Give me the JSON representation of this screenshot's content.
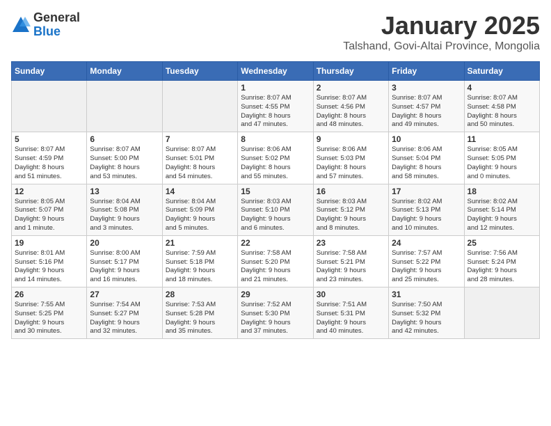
{
  "header": {
    "logo_general": "General",
    "logo_blue": "Blue",
    "month_title": "January 2025",
    "location": "Talshand, Govi-Altai Province, Mongolia"
  },
  "weekdays": [
    "Sunday",
    "Monday",
    "Tuesday",
    "Wednesday",
    "Thursday",
    "Friday",
    "Saturday"
  ],
  "weeks": [
    [
      {
        "day": "",
        "info": ""
      },
      {
        "day": "",
        "info": ""
      },
      {
        "day": "",
        "info": ""
      },
      {
        "day": "1",
        "info": "Sunrise: 8:07 AM\nSunset: 4:55 PM\nDaylight: 8 hours\nand 47 minutes."
      },
      {
        "day": "2",
        "info": "Sunrise: 8:07 AM\nSunset: 4:56 PM\nDaylight: 8 hours\nand 48 minutes."
      },
      {
        "day": "3",
        "info": "Sunrise: 8:07 AM\nSunset: 4:57 PM\nDaylight: 8 hours\nand 49 minutes."
      },
      {
        "day": "4",
        "info": "Sunrise: 8:07 AM\nSunset: 4:58 PM\nDaylight: 8 hours\nand 50 minutes."
      }
    ],
    [
      {
        "day": "5",
        "info": "Sunrise: 8:07 AM\nSunset: 4:59 PM\nDaylight: 8 hours\nand 51 minutes."
      },
      {
        "day": "6",
        "info": "Sunrise: 8:07 AM\nSunset: 5:00 PM\nDaylight: 8 hours\nand 53 minutes."
      },
      {
        "day": "7",
        "info": "Sunrise: 8:07 AM\nSunset: 5:01 PM\nDaylight: 8 hours\nand 54 minutes."
      },
      {
        "day": "8",
        "info": "Sunrise: 8:06 AM\nSunset: 5:02 PM\nDaylight: 8 hours\nand 55 minutes."
      },
      {
        "day": "9",
        "info": "Sunrise: 8:06 AM\nSunset: 5:03 PM\nDaylight: 8 hours\nand 57 minutes."
      },
      {
        "day": "10",
        "info": "Sunrise: 8:06 AM\nSunset: 5:04 PM\nDaylight: 8 hours\nand 58 minutes."
      },
      {
        "day": "11",
        "info": "Sunrise: 8:05 AM\nSunset: 5:05 PM\nDaylight: 9 hours\nand 0 minutes."
      }
    ],
    [
      {
        "day": "12",
        "info": "Sunrise: 8:05 AM\nSunset: 5:07 PM\nDaylight: 9 hours\nand 1 minute."
      },
      {
        "day": "13",
        "info": "Sunrise: 8:04 AM\nSunset: 5:08 PM\nDaylight: 9 hours\nand 3 minutes."
      },
      {
        "day": "14",
        "info": "Sunrise: 8:04 AM\nSunset: 5:09 PM\nDaylight: 9 hours\nand 5 minutes."
      },
      {
        "day": "15",
        "info": "Sunrise: 8:03 AM\nSunset: 5:10 PM\nDaylight: 9 hours\nand 6 minutes."
      },
      {
        "day": "16",
        "info": "Sunrise: 8:03 AM\nSunset: 5:12 PM\nDaylight: 9 hours\nand 8 minutes."
      },
      {
        "day": "17",
        "info": "Sunrise: 8:02 AM\nSunset: 5:13 PM\nDaylight: 9 hours\nand 10 minutes."
      },
      {
        "day": "18",
        "info": "Sunrise: 8:02 AM\nSunset: 5:14 PM\nDaylight: 9 hours\nand 12 minutes."
      }
    ],
    [
      {
        "day": "19",
        "info": "Sunrise: 8:01 AM\nSunset: 5:16 PM\nDaylight: 9 hours\nand 14 minutes."
      },
      {
        "day": "20",
        "info": "Sunrise: 8:00 AM\nSunset: 5:17 PM\nDaylight: 9 hours\nand 16 minutes."
      },
      {
        "day": "21",
        "info": "Sunrise: 7:59 AM\nSunset: 5:18 PM\nDaylight: 9 hours\nand 18 minutes."
      },
      {
        "day": "22",
        "info": "Sunrise: 7:58 AM\nSunset: 5:20 PM\nDaylight: 9 hours\nand 21 minutes."
      },
      {
        "day": "23",
        "info": "Sunrise: 7:58 AM\nSunset: 5:21 PM\nDaylight: 9 hours\nand 23 minutes."
      },
      {
        "day": "24",
        "info": "Sunrise: 7:57 AM\nSunset: 5:22 PM\nDaylight: 9 hours\nand 25 minutes."
      },
      {
        "day": "25",
        "info": "Sunrise: 7:56 AM\nSunset: 5:24 PM\nDaylight: 9 hours\nand 28 minutes."
      }
    ],
    [
      {
        "day": "26",
        "info": "Sunrise: 7:55 AM\nSunset: 5:25 PM\nDaylight: 9 hours\nand 30 minutes."
      },
      {
        "day": "27",
        "info": "Sunrise: 7:54 AM\nSunset: 5:27 PM\nDaylight: 9 hours\nand 32 minutes."
      },
      {
        "day": "28",
        "info": "Sunrise: 7:53 AM\nSunset: 5:28 PM\nDaylight: 9 hours\nand 35 minutes."
      },
      {
        "day": "29",
        "info": "Sunrise: 7:52 AM\nSunset: 5:30 PM\nDaylight: 9 hours\nand 37 minutes."
      },
      {
        "day": "30",
        "info": "Sunrise: 7:51 AM\nSunset: 5:31 PM\nDaylight: 9 hours\nand 40 minutes."
      },
      {
        "day": "31",
        "info": "Sunrise: 7:50 AM\nSunset: 5:32 PM\nDaylight: 9 hours\nand 42 minutes."
      },
      {
        "day": "",
        "info": ""
      }
    ]
  ]
}
